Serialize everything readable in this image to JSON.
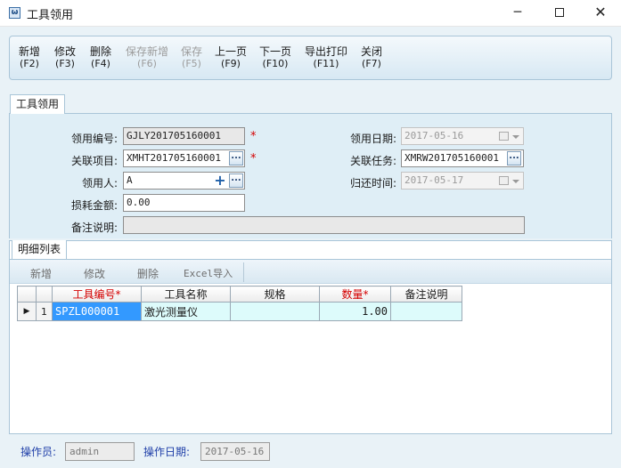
{
  "window": {
    "title": "工具领用",
    "icon_text": "ω",
    "minimize": "─",
    "close": "✕"
  },
  "toolbar": {
    "new": {
      "label": "新增",
      "key": "(F2)"
    },
    "edit": {
      "label": "修改",
      "key": "(F3)"
    },
    "delete": {
      "label": "删除",
      "key": "(F4)"
    },
    "save_new": {
      "label": "保存新增",
      "key": "(F6)"
    },
    "save": {
      "label": "保存",
      "key": "(F5)"
    },
    "prev": {
      "label": "上一页",
      "key": "(F9)"
    },
    "next": {
      "label": "下一页",
      "key": "(F10)"
    },
    "export_print": {
      "label": "导出打印",
      "key": "(F11)"
    },
    "close": {
      "label": "关闭",
      "key": "(F7)"
    }
  },
  "main_tab": {
    "label": "工具领用"
  },
  "form": {
    "receive_no": {
      "label": "领用编号:",
      "value": "GJLY201705160001"
    },
    "project": {
      "label": "关联项目:",
      "value": "XMHT201705160001"
    },
    "receiver": {
      "label": "领用人:",
      "value": "A"
    },
    "loss_amount": {
      "label": "损耗金额:",
      "value": "0.00"
    },
    "remark": {
      "label": "备注说明:",
      "value": ""
    },
    "receive_date": {
      "label": "领用日期:",
      "value": "2017-05-16"
    },
    "task": {
      "label": "关联任务:",
      "value": "XMRW201705160001"
    },
    "return_time": {
      "label": "归还时间:",
      "value": "2017-05-17"
    },
    "required_mark": "*",
    "browse_btn": "...",
    "add_btn": "+"
  },
  "detail_tab": {
    "label": "明细列表"
  },
  "detail_toolbar": {
    "new": "新增",
    "edit": "修改",
    "delete": "删除",
    "excel_import": "Excel导入"
  },
  "grid": {
    "columns": [
      {
        "label": "工具编号*",
        "required": true
      },
      {
        "label": "工具名称",
        "required": false
      },
      {
        "label": "规格",
        "required": false
      },
      {
        "label": "数量*",
        "required": true
      },
      {
        "label": "备注说明",
        "required": false
      }
    ],
    "rows": [
      {
        "indicator": "▶",
        "index": "1",
        "code": "SPZL000001",
        "name": "激光测量仪",
        "spec": "",
        "qty": "1.00",
        "remark": ""
      }
    ]
  },
  "footer": {
    "operator_label": "操作员:",
    "operator_value": "admin",
    "date_label": "操作日期:",
    "date_value": "2017-05-16"
  },
  "colors": {
    "accent_blue": "#1f3fa8",
    "required_red": "#d40000",
    "selected_cell": "#3399ff",
    "panel_bg": "#dfeef6"
  }
}
